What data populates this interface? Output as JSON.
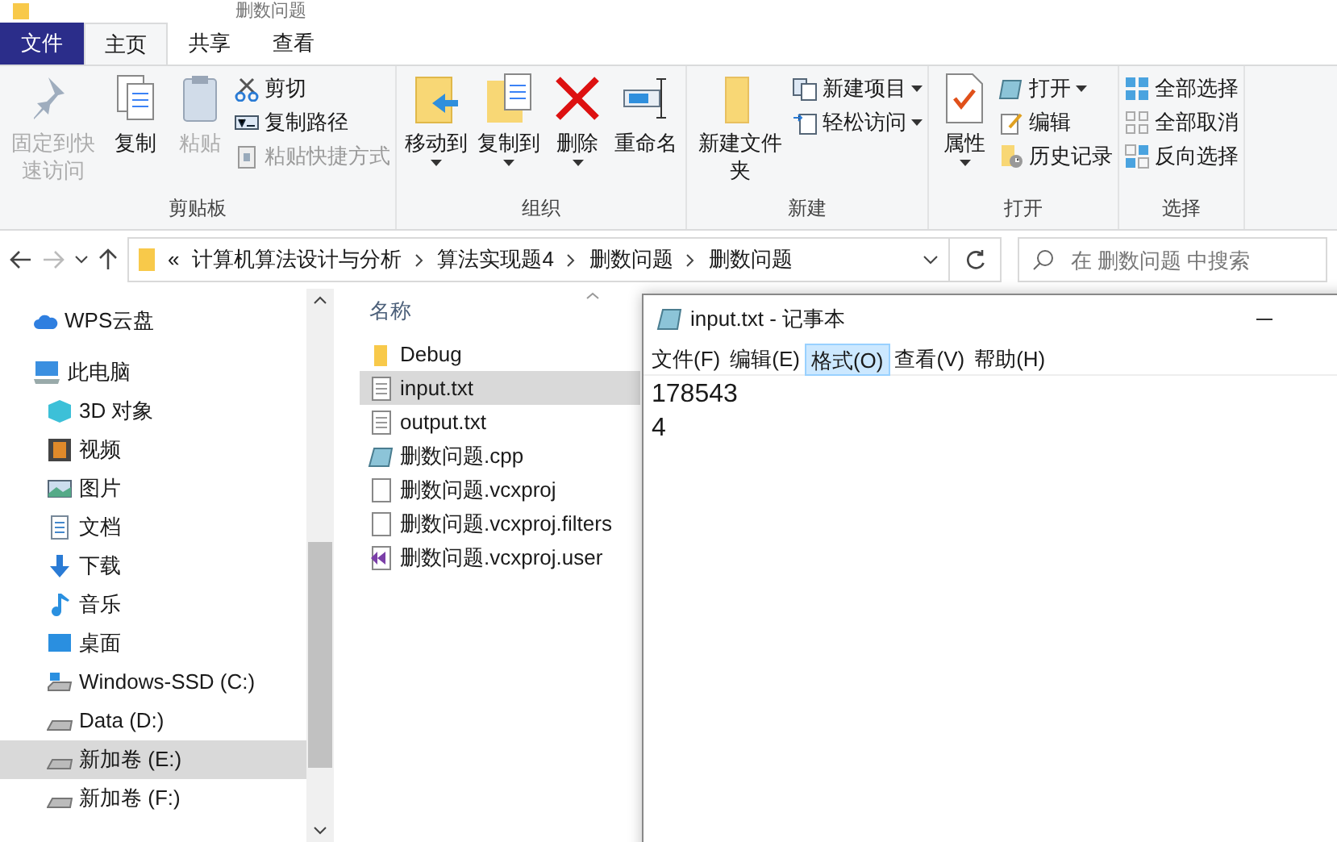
{
  "window": {
    "title": "删数问题"
  },
  "ribbon_tabs": [
    {
      "label": "文件",
      "kind": "file",
      "selected": false
    },
    {
      "label": "主页",
      "kind": "tab",
      "selected": true
    },
    {
      "label": "共享",
      "kind": "tab",
      "selected": false
    },
    {
      "label": "查看",
      "kind": "tab",
      "selected": false
    }
  ],
  "ribbon_groups": [
    {
      "name": "剪贴板",
      "items": [
        {
          "kind": "large",
          "label": "固定到快速访问",
          "disabled": true,
          "has_menu": false
        },
        {
          "kind": "large",
          "label": "复制",
          "disabled": false,
          "has_menu": false
        },
        {
          "kind": "large",
          "label": "粘贴",
          "disabled": true,
          "has_menu": false
        },
        {
          "kind": "small",
          "label": "剪切",
          "disabled": false,
          "has_menu": false
        },
        {
          "kind": "small",
          "label": "复制路径",
          "disabled": false,
          "has_menu": false
        },
        {
          "kind": "small",
          "label": "粘贴快捷方式",
          "disabled": true,
          "has_menu": false
        }
      ]
    },
    {
      "name": "组织",
      "items": [
        {
          "kind": "large",
          "label": "移动到",
          "disabled": false,
          "has_menu": true
        },
        {
          "kind": "large",
          "label": "复制到",
          "disabled": false,
          "has_menu": true
        },
        {
          "kind": "large",
          "label": "删除",
          "disabled": false,
          "has_menu": true
        },
        {
          "kind": "large",
          "label": "重命名",
          "disabled": false,
          "has_menu": false
        }
      ]
    },
    {
      "name": "新建",
      "items": [
        {
          "kind": "large",
          "label": "新建文件夹",
          "disabled": false,
          "has_menu": false
        },
        {
          "kind": "small",
          "label": "新建项目",
          "disabled": false,
          "has_menu": true
        },
        {
          "kind": "small",
          "label": "轻松访问",
          "disabled": false,
          "has_menu": true
        }
      ]
    },
    {
      "name": "打开",
      "items": [
        {
          "kind": "large",
          "label": "属性",
          "disabled": false,
          "has_menu": true
        },
        {
          "kind": "small",
          "label": "打开",
          "disabled": false,
          "has_menu": true
        },
        {
          "kind": "small",
          "label": "编辑",
          "disabled": false,
          "has_menu": false
        },
        {
          "kind": "small",
          "label": "历史记录",
          "disabled": false,
          "has_menu": false
        }
      ]
    },
    {
      "name": "选择",
      "items": [
        {
          "kind": "small",
          "label": "全部选择",
          "disabled": false,
          "has_menu": false
        },
        {
          "kind": "small",
          "label": "全部取消",
          "disabled": false,
          "has_menu": false
        },
        {
          "kind": "small",
          "label": "反向选择",
          "disabled": false,
          "has_menu": false
        }
      ]
    }
  ],
  "address_bar": {
    "overflow": "«",
    "path": [
      "计算机算法设计与分析",
      "算法实现题4",
      "删数问题",
      "删数问题"
    ]
  },
  "search": {
    "placeholder": "在 删数问题 中搜索"
  },
  "navigation": [
    {
      "label": "WPS云盘",
      "selected": false
    },
    {
      "label": "此电脑",
      "selected": false,
      "children": [
        {
          "label": "3D 对象",
          "selected": false
        },
        {
          "label": "视频",
          "selected": false
        },
        {
          "label": "图片",
          "selected": false
        },
        {
          "label": "文档",
          "selected": false
        },
        {
          "label": "下载",
          "selected": false
        },
        {
          "label": "音乐",
          "selected": false
        },
        {
          "label": "桌面",
          "selected": false
        },
        {
          "label": "Windows-SSD (C:)",
          "selected": false
        },
        {
          "label": "Data (D:)",
          "selected": false
        },
        {
          "label": "新加卷 (E:)",
          "selected": true
        },
        {
          "label": "新加卷 (F:)",
          "selected": false
        }
      ]
    }
  ],
  "file_list": {
    "columns": [
      "名称"
    ],
    "files": [
      {
        "name": "Debug",
        "selected": false
      },
      {
        "name": "input.txt",
        "selected": true
      },
      {
        "name": "output.txt",
        "selected": false
      },
      {
        "name": "删数问题.cpp",
        "selected": false
      },
      {
        "name": "删数问题.vcxproj",
        "selected": false
      },
      {
        "name": "删数问题.vcxproj.filters",
        "selected": false
      },
      {
        "name": "删数问题.vcxproj.user",
        "selected": false
      }
    ]
  },
  "notepad": {
    "title": "input.txt - 记事本",
    "menu": [
      {
        "label": "文件(F)",
        "selected": false
      },
      {
        "label": "编辑(E)",
        "selected": false
      },
      {
        "label": "格式(O)",
        "selected": true
      },
      {
        "label": "查看(V)",
        "selected": false
      },
      {
        "label": "帮助(H)",
        "selected": false
      }
    ],
    "lines": [
      "178543",
      "4"
    ]
  }
}
